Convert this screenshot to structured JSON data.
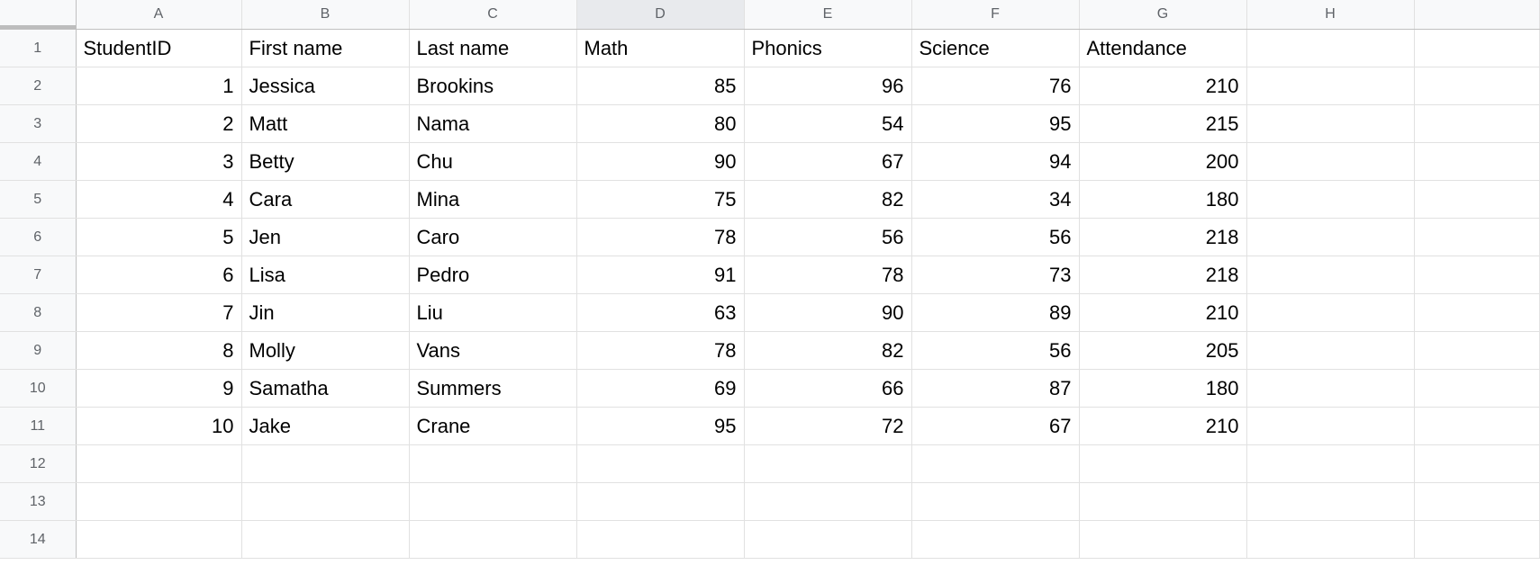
{
  "columns": {
    "letters": [
      "A",
      "B",
      "C",
      "D",
      "E",
      "F",
      "G",
      "H"
    ],
    "selected": "D"
  },
  "rows": {
    "count": 14
  },
  "headers": {
    "A": "StudentID",
    "B": "First name",
    "C": "Last name",
    "D": "Math",
    "E": "Phonics",
    "F": "Science",
    "G": "Attendance"
  },
  "data": [
    {
      "id": "1",
      "first": "Jessica",
      "last": "Brookins",
      "math": "85",
      "phonics": "96",
      "science": "76",
      "att": "210"
    },
    {
      "id": "2",
      "first": "Matt",
      "last": "Nama",
      "math": "80",
      "phonics": "54",
      "science": "95",
      "att": "215"
    },
    {
      "id": "3",
      "first": "Betty",
      "last": "Chu",
      "math": "90",
      "phonics": "67",
      "science": "94",
      "att": "200"
    },
    {
      "id": "4",
      "first": "Cara",
      "last": "Mina",
      "math": "75",
      "phonics": "82",
      "science": "34",
      "att": "180"
    },
    {
      "id": "5",
      "first": "Jen",
      "last": "Caro",
      "math": "78",
      "phonics": "56",
      "science": "56",
      "att": "218"
    },
    {
      "id": "6",
      "first": "Lisa",
      "last": "Pedro",
      "math": "91",
      "phonics": "78",
      "science": "73",
      "att": "218"
    },
    {
      "id": "7",
      "first": "Jin",
      "last": "Liu",
      "math": "63",
      "phonics": "90",
      "science": "89",
      "att": "210"
    },
    {
      "id": "8",
      "first": "Molly",
      "last": "Vans",
      "math": "78",
      "phonics": "82",
      "science": "56",
      "att": "205"
    },
    {
      "id": "9",
      "first": "Samatha",
      "last": "Summers",
      "math": "69",
      "phonics": "66",
      "science": "87",
      "att": "180"
    },
    {
      "id": "10",
      "first": "Jake",
      "last": "Crane",
      "math": "95",
      "phonics": "72",
      "science": "67",
      "att": "210"
    }
  ],
  "chart_data": {
    "type": "table",
    "columns": [
      "StudentID",
      "First name",
      "Last name",
      "Math",
      "Phonics",
      "Science",
      "Attendance"
    ],
    "rows": [
      [
        1,
        "Jessica",
        "Brookins",
        85,
        96,
        76,
        210
      ],
      [
        2,
        "Matt",
        "Nama",
        80,
        54,
        95,
        215
      ],
      [
        3,
        "Betty",
        "Chu",
        90,
        67,
        94,
        200
      ],
      [
        4,
        "Cara",
        "Mina",
        75,
        82,
        34,
        180
      ],
      [
        5,
        "Jen",
        "Caro",
        78,
        56,
        56,
        218
      ],
      [
        6,
        "Lisa",
        "Pedro",
        91,
        78,
        73,
        218
      ],
      [
        7,
        "Jin",
        "Liu",
        63,
        90,
        89,
        210
      ],
      [
        8,
        "Molly",
        "Vans",
        78,
        82,
        56,
        205
      ],
      [
        9,
        "Samatha",
        "Summers",
        69,
        66,
        87,
        180
      ],
      [
        10,
        "Jake",
        "Crane",
        95,
        72,
        67,
        210
      ]
    ]
  }
}
